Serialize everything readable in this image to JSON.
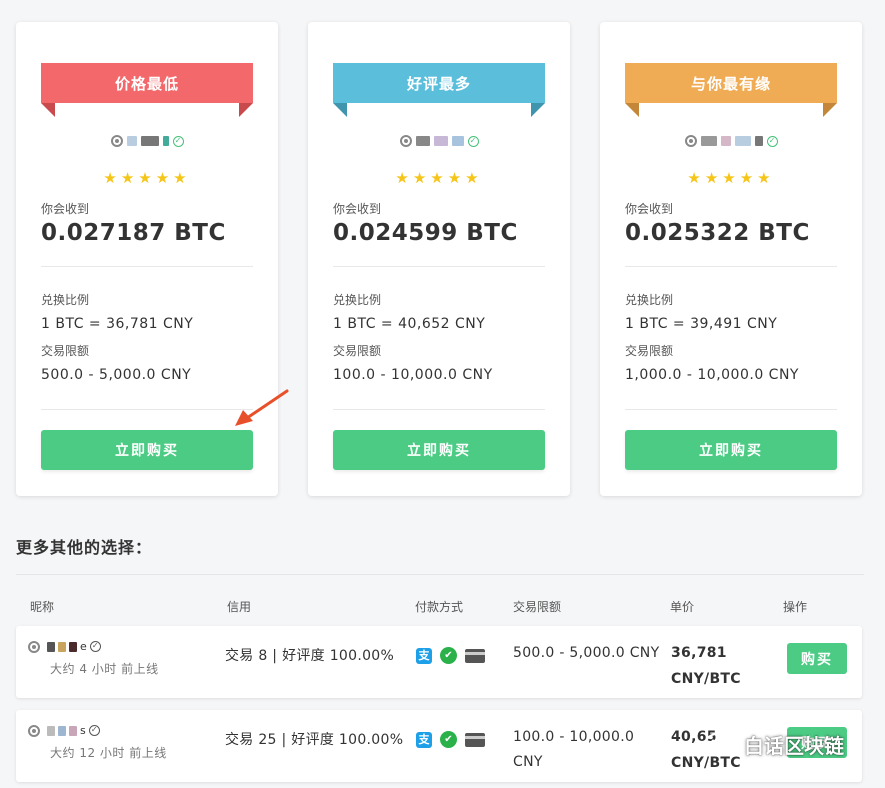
{
  "cards": [
    {
      "ribbon": "价格最低",
      "ribbon_color": "#f2686b",
      "fold_color": "#c94a4d",
      "receive_label": "你会收到",
      "receive_value": "0.027187 BTC",
      "rate_label": "兑换比例",
      "rate_value": "1 BTC = 36,781 CNY",
      "limit_label": "交易限额",
      "limit_value": "500.0 - 5,000.0 CNY",
      "button": "立即购买",
      "rating_stars": 5
    },
    {
      "ribbon": "好评最多",
      "ribbon_color": "#5bbfdc",
      "fold_color": "#3f95ad",
      "receive_label": "你会收到",
      "receive_value": "0.024599 BTC",
      "rate_label": "兑换比例",
      "rate_value": "1 BTC = 40,652 CNY",
      "limit_label": "交易限额",
      "limit_value": "100.0 - 10,000.0 CNY",
      "button": "立即购买",
      "rating_stars": 5
    },
    {
      "ribbon": "与你最有缘",
      "ribbon_color": "#efac55",
      "fold_color": "#c4873a",
      "receive_label": "你会收到",
      "receive_value": "0.025322 BTC",
      "rate_label": "兑换比例",
      "rate_value": "1 BTC = 39,491 CNY",
      "limit_label": "交易限额",
      "limit_value": "1,000.0 - 10,000.0 CNY",
      "button": "立即购买",
      "rating_stars": 5
    }
  ],
  "more_title": "更多其他的选择：",
  "table": {
    "headers": [
      "昵称",
      "信用",
      "付款方式",
      "交易限额",
      "单价",
      "操作"
    ],
    "rows": [
      {
        "online": "大约 4 小时 前上线",
        "credit": "交易 8 | 好评度 100.00%",
        "limit_line1": "500.0 - 5,000.0 CNY",
        "limit_line2": "",
        "price_line1": "36,781",
        "price_line2": "CNY/BTC",
        "action": "购买"
      },
      {
        "online": "大约 12 小时 前上线",
        "credit": "交易 25 | 好评度 100.00%",
        "limit_line1": "100.0 - 10,000.0",
        "limit_line2": "CNY",
        "price_line1": "40,65",
        "price_line2": "CNY/BTC",
        "action": "购买"
      }
    ]
  },
  "payment_icons": [
    "alipay-icon",
    "wechat-icon",
    "bank-card-icon"
  ],
  "watermark": "白话区块链",
  "colors": {
    "buy_green": "#4ccb84",
    "star": "#f5c518",
    "verified": "#45c17a",
    "arrow": "#e8502a"
  }
}
